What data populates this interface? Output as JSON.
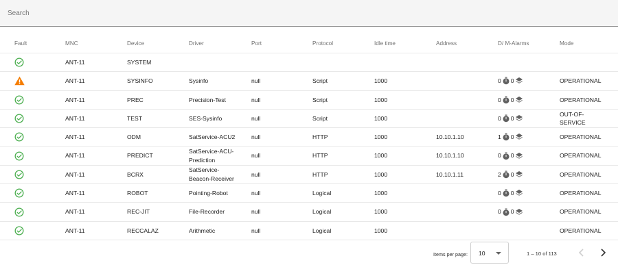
{
  "search": {
    "placeholder": "Search"
  },
  "columns": [
    "Fault",
    "MNC",
    "Device",
    "Driver",
    "Port",
    "Protocol",
    "Idle time",
    "Address",
    "D/ M-Alarms",
    "Mode"
  ],
  "rows": [
    {
      "fault": "ok",
      "mnc": "ANT-11",
      "device": "SYSTEM",
      "driver": "",
      "port": "",
      "protocol": "",
      "idle": "",
      "address": "",
      "alarms": null,
      "mode": ""
    },
    {
      "fault": "warning",
      "mnc": "ANT-11",
      "device": "SYSINFO",
      "driver": "Sysinfo",
      "port": "null",
      "protocol": "Script",
      "idle": "1000",
      "address": "",
      "alarms": {
        "d": "0",
        "m": "0"
      },
      "mode": "OPERATIONAL"
    },
    {
      "fault": "ok",
      "mnc": "ANT-11",
      "device": "PREC",
      "driver": "Precision-Test",
      "port": "null",
      "protocol": "Script",
      "idle": "1000",
      "address": "",
      "alarms": {
        "d": "0",
        "m": "0"
      },
      "mode": "OPERATIONAL"
    },
    {
      "fault": "ok",
      "mnc": "ANT-11",
      "device": "TEST",
      "driver": "SES-Sysinfo",
      "port": "null",
      "protocol": "Script",
      "idle": "1000",
      "address": "",
      "alarms": {
        "d": "0",
        "m": "0"
      },
      "mode": "OUT-OF-\nSERVICE"
    },
    {
      "fault": "ok",
      "mnc": "ANT-11",
      "device": "ODM",
      "driver": "SatService-ACU2",
      "port": "null",
      "protocol": "HTTP",
      "idle": "1000",
      "address": "10.10.1.10",
      "alarms": {
        "d": "1",
        "m": "0"
      },
      "mode": "OPERATIONAL"
    },
    {
      "fault": "ok",
      "mnc": "ANT-11",
      "device": "PREDICT",
      "driver": "SatService-ACU-\nPrediction",
      "port": "null",
      "protocol": "HTTP",
      "idle": "1000",
      "address": "10.10.1.10",
      "alarms": {
        "d": "0",
        "m": "0"
      },
      "mode": "OPERATIONAL"
    },
    {
      "fault": "ok",
      "mnc": "ANT-11",
      "device": "BCRX",
      "driver": "SatService-\nBeacon-Receiver",
      "port": "null",
      "protocol": "HTTP",
      "idle": "1000",
      "address": "10.10.1.11",
      "alarms": {
        "d": "2",
        "m": "0"
      },
      "mode": "OPERATIONAL"
    },
    {
      "fault": "ok",
      "mnc": "ANT-11",
      "device": "ROBOT",
      "driver": "Pointing-Robot",
      "port": "null",
      "protocol": "Logical",
      "idle": "1000",
      "address": "",
      "alarms": {
        "d": "0",
        "m": "0"
      },
      "mode": "OPERATIONAL"
    },
    {
      "fault": "ok",
      "mnc": "ANT-11",
      "device": "REC-JIT",
      "driver": "File-Recorder",
      "port": "null",
      "protocol": "Logical",
      "idle": "1000",
      "address": "",
      "alarms": {
        "d": "0",
        "m": "0"
      },
      "mode": "OPERATIONAL"
    },
    {
      "fault": "ok",
      "mnc": "ANT-11",
      "device": "RECCALAZ",
      "driver": "Arithmetic",
      "port": "null",
      "protocol": "Logical",
      "idle": "1000",
      "address": "",
      "alarms": null,
      "mode": "OPERATIONAL"
    }
  ],
  "icons": {
    "fault_ok": "check-circle-icon",
    "fault_warning": "warning-icon",
    "d_alarm": "stopwatch-icon",
    "m_alarm": "layers-icon",
    "prev": "chevron-left-icon",
    "next": "chevron-right-icon"
  },
  "colors": {
    "ok": "#4caf50",
    "warning": "#f57c00",
    "alarm_icon": "#616161"
  },
  "paginator": {
    "items_per_page_label": "Items per page:",
    "page_size": "10",
    "range_label": "1 – 10 of 113"
  }
}
